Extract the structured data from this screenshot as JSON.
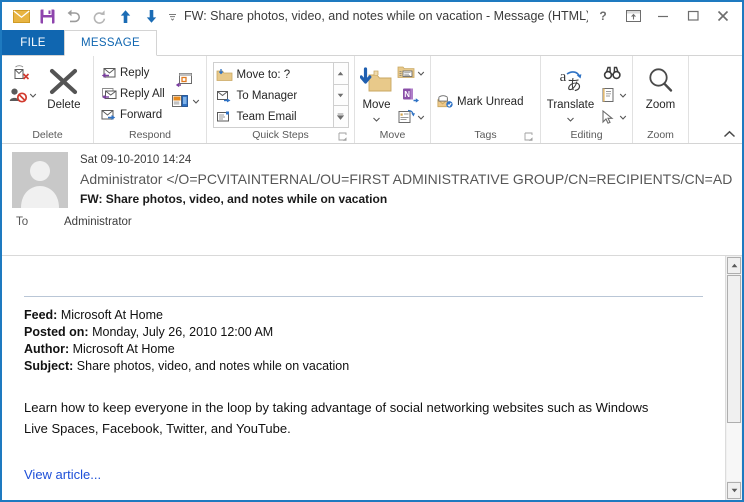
{
  "window": {
    "title": "FW: Share photos, video, and notes while on vacation - Message (HTML)",
    "accent_color": "#1066b0",
    "border_color": "#1e7ac0",
    "quick_access": [
      {
        "name": "mail-icon",
        "tooltip": "Mail"
      },
      {
        "name": "save-icon",
        "tooltip": "Save"
      },
      {
        "name": "undo-icon",
        "tooltip": "Undo"
      },
      {
        "name": "redo-icon",
        "tooltip": "Redo"
      },
      {
        "name": "previous-item-icon",
        "tooltip": "Previous Item"
      },
      {
        "name": "next-item-icon",
        "tooltip": "Next Item"
      },
      {
        "name": "customize-quick-access-toolbar-icon",
        "tooltip": "Customize Quick Access Toolbar"
      }
    ],
    "controls": [
      {
        "name": "help-button",
        "glyph": "?"
      },
      {
        "name": "ribbon-display-options-button",
        "glyph": "ribbon"
      },
      {
        "name": "minimize-button",
        "glyph": "minimize"
      },
      {
        "name": "maximize-button",
        "glyph": "maximize"
      },
      {
        "name": "close-button",
        "glyph": "close"
      }
    ]
  },
  "tabs": [
    {
      "id": "file",
      "label": "FILE",
      "active": false
    },
    {
      "id": "message",
      "label": "MESSAGE",
      "active": true
    }
  ],
  "ribbon": {
    "collapse_label": "Collapse the Ribbon",
    "groups": [
      {
        "id": "delete",
        "label": "Delete",
        "items": [
          {
            "name": "ignore-button",
            "label": "Ignore"
          },
          {
            "name": "junk-button",
            "label": "Junk",
            "has_dropdown": true
          },
          {
            "name": "delete-button",
            "label": "Delete"
          }
        ]
      },
      {
        "id": "respond",
        "label": "Respond",
        "items": [
          {
            "name": "reply-button",
            "label": "Reply"
          },
          {
            "name": "reply-all-button",
            "label": "Reply All"
          },
          {
            "name": "forward-button",
            "label": "Forward"
          },
          {
            "name": "meeting-button",
            "label": "Meeting"
          },
          {
            "name": "more-respond-button",
            "label": "More",
            "has_dropdown": true
          }
        ]
      },
      {
        "id": "quick-steps",
        "label": "Quick Steps",
        "has_dialog_launcher": true,
        "items": [
          {
            "name": "quick-step-move-to",
            "label": "Move to: ?"
          },
          {
            "name": "quick-step-to-manager",
            "label": "To Manager"
          },
          {
            "name": "quick-step-team-email",
            "label": "Team Email"
          }
        ],
        "scroll_buttons": [
          {
            "name": "quick-steps-scroll-up",
            "glyph": "up"
          },
          {
            "name": "quick-steps-scroll-down",
            "glyph": "down"
          },
          {
            "name": "quick-steps-more",
            "glyph": "more"
          }
        ]
      },
      {
        "id": "move",
        "label": "Move",
        "items": [
          {
            "name": "move-button",
            "label": "Move",
            "has_dropdown": true
          },
          {
            "name": "rules-button",
            "label": "Rules",
            "has_dropdown": true
          },
          {
            "name": "onenote-button",
            "label": "OneNote"
          },
          {
            "name": "actions-button",
            "label": "Actions",
            "has_dropdown": true
          }
        ]
      },
      {
        "id": "tags",
        "label": "Tags",
        "has_dialog_launcher": true,
        "items": [
          {
            "name": "mark-unread-button",
            "label": "Mark Unread"
          }
        ]
      },
      {
        "id": "editing",
        "label": "Editing",
        "items": [
          {
            "name": "translate-button",
            "label": "Translate",
            "has_dropdown": true
          },
          {
            "name": "find-button",
            "label": "Find"
          },
          {
            "name": "related-button",
            "label": "Related",
            "has_dropdown": true
          },
          {
            "name": "select-button",
            "label": "Select",
            "has_dropdown": true
          }
        ]
      },
      {
        "id": "zoom",
        "label": "Zoom",
        "items": [
          {
            "name": "zoom-button",
            "label": "Zoom"
          }
        ]
      }
    ]
  },
  "message_header": {
    "date": "Sat 09-10-2010 14:24",
    "from": "Administrator </O=PCVITAINTERNAL/OU=FIRST ADMINISTRATIVE GROUP/CN=RECIPIENTS/CN=AD",
    "subject": "FW: Share photos, video, and notes while on vacation",
    "to_label": "To",
    "to_value": "Administrator"
  },
  "body": {
    "meta": [
      {
        "key": "Feed:",
        "value": "Microsoft At Home"
      },
      {
        "key": "Posted on:",
        "value": "Monday, July 26, 2010 12:00 AM"
      },
      {
        "key": "Author:",
        "value": "Microsoft At Home"
      },
      {
        "key": "Subject:",
        "value": "Share photos, video, and notes while on vacation"
      }
    ],
    "paragraph": "Learn how to keep everyone in the loop by taking advantage of social networking websites such as Windows Live Spaces, Facebook, Twitter, and YouTube.",
    "link_text": "View article...",
    "link_color": "#1d4fd8"
  },
  "scrollbar": {
    "up_label": "Scroll up",
    "down_label": "Scroll down",
    "thumb_label": "Scroll thumb"
  }
}
